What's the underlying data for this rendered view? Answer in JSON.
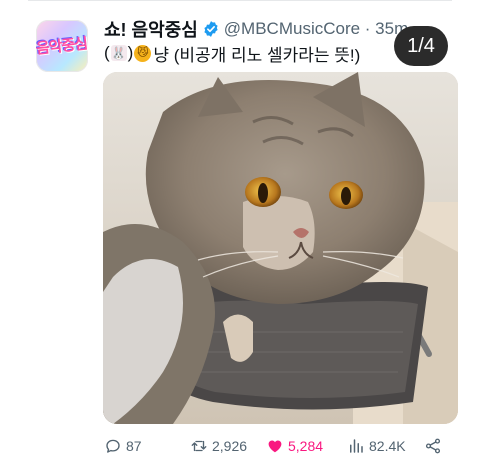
{
  "tweet": {
    "avatar_logo_text": "음악중심",
    "display_name": "쇼! 음악중심",
    "handle_time": "@MBCMusicCore · 35m",
    "caption": {
      "open_paren": "(",
      "bunny_emoji": "🐰",
      "close_paren": ")",
      "cat_emoji": "😼",
      "text": "냥 (비공개 리노 셀카라는 뜻!)"
    },
    "media_counter": "1/4"
  },
  "actions": {
    "replies": "87",
    "retweets": "2,926",
    "likes": "5,284",
    "views": "82.4K"
  },
  "colors": {
    "verified": "#1d9bf0",
    "like": "#f91880",
    "muted": "#536471",
    "counter_bg": "#2b2b2b"
  },
  "icons": {
    "reply": "reply-icon",
    "retweet": "retweet-icon",
    "like": "heart-icon",
    "views": "views-icon",
    "share": "share-icon",
    "verified": "verified-badge-icon"
  }
}
